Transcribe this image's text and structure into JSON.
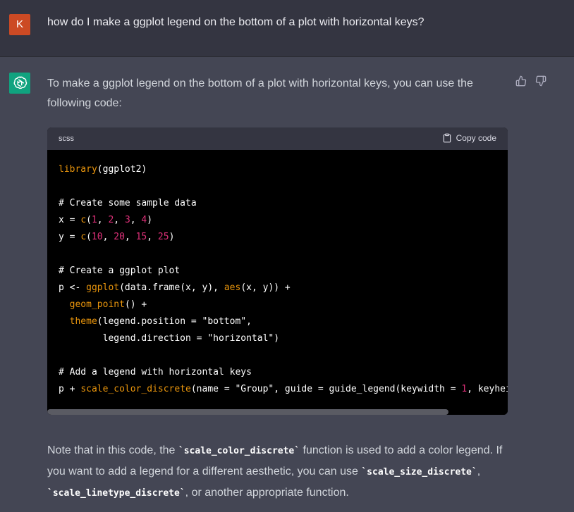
{
  "user": {
    "avatar_letter": "K",
    "avatar_color": "#cc4a24",
    "message": "how do I make a ggplot legend on the bottom of a plot with horizontal keys?"
  },
  "assistant": {
    "avatar_icon": "openai-logo-icon",
    "avatar_color": "#10a37f",
    "feedback": {
      "like_icon": "thumbs-up-icon",
      "dislike_icon": "thumbs-down-icon"
    },
    "intro": "To make a ggplot legend on the bottom of a plot with horizontal keys, you can use the following code:",
    "code": {
      "language": "scss",
      "copy_label": "Copy code",
      "copy_icon": "clipboard-icon",
      "lines": [
        [
          {
            "t": "library",
            "c": "kw"
          },
          {
            "t": "(ggplot2)",
            "c": "plain"
          }
        ],
        [],
        [
          {
            "t": "# Create some sample data",
            "c": "cm"
          }
        ],
        [
          {
            "t": "x = ",
            "c": "plain"
          },
          {
            "t": "c",
            "c": "kw"
          },
          {
            "t": "(",
            "c": "plain"
          },
          {
            "t": "1",
            "c": "num"
          },
          {
            "t": ", ",
            "c": "plain"
          },
          {
            "t": "2",
            "c": "num"
          },
          {
            "t": ", ",
            "c": "plain"
          },
          {
            "t": "3",
            "c": "num"
          },
          {
            "t": ", ",
            "c": "plain"
          },
          {
            "t": "4",
            "c": "num"
          },
          {
            "t": ")",
            "c": "plain"
          }
        ],
        [
          {
            "t": "y = ",
            "c": "plain"
          },
          {
            "t": "c",
            "c": "kw"
          },
          {
            "t": "(",
            "c": "plain"
          },
          {
            "t": "10",
            "c": "num"
          },
          {
            "t": ", ",
            "c": "plain"
          },
          {
            "t": "20",
            "c": "num"
          },
          {
            "t": ", ",
            "c": "plain"
          },
          {
            "t": "15",
            "c": "num"
          },
          {
            "t": ", ",
            "c": "plain"
          },
          {
            "t": "25",
            "c": "num"
          },
          {
            "t": ")",
            "c": "plain"
          }
        ],
        [],
        [
          {
            "t": "# Create a ggplot plot",
            "c": "cm"
          }
        ],
        [
          {
            "t": "p <- ",
            "c": "plain"
          },
          {
            "t": "ggplot",
            "c": "kw"
          },
          {
            "t": "(data.frame(x, y), ",
            "c": "plain"
          },
          {
            "t": "aes",
            "c": "kw"
          },
          {
            "t": "(x, y)) +",
            "c": "plain"
          }
        ],
        [
          {
            "t": "  ",
            "c": "plain"
          },
          {
            "t": "geom_point",
            "c": "kw"
          },
          {
            "t": "() +",
            "c": "plain"
          }
        ],
        [
          {
            "t": "  ",
            "c": "plain"
          },
          {
            "t": "theme",
            "c": "kw"
          },
          {
            "t": "(legend.position = \"bottom\",",
            "c": "plain"
          }
        ],
        [
          {
            "t": "        legend.direction = \"horizontal\")",
            "c": "plain"
          }
        ],
        [],
        [
          {
            "t": "# Add a legend with horizontal keys",
            "c": "cm"
          }
        ],
        [
          {
            "t": "p + ",
            "c": "plain"
          },
          {
            "t": "scale_color_discrete",
            "c": "kw"
          },
          {
            "t": "(name = \"Group\", guide = guide_legend(keywidth = ",
            "c": "plain"
          },
          {
            "t": "1",
            "c": "num"
          },
          {
            "t": ", keyheig",
            "c": "plain"
          }
        ]
      ]
    },
    "note": [
      {
        "t": "Note that in this code, the ",
        "code": false
      },
      {
        "t": "`scale_color_discrete`",
        "code": true
      },
      {
        "t": " function is used to add a color legend. If you want to add a legend for a different aesthetic, you can use ",
        "code": false
      },
      {
        "t": "`scale_size_discrete`",
        "code": true
      },
      {
        "t": ", ",
        "code": false
      },
      {
        "t": "`scale_linetype_discrete`",
        "code": true
      },
      {
        "t": ", or another appropriate function.",
        "code": false
      }
    ]
  }
}
